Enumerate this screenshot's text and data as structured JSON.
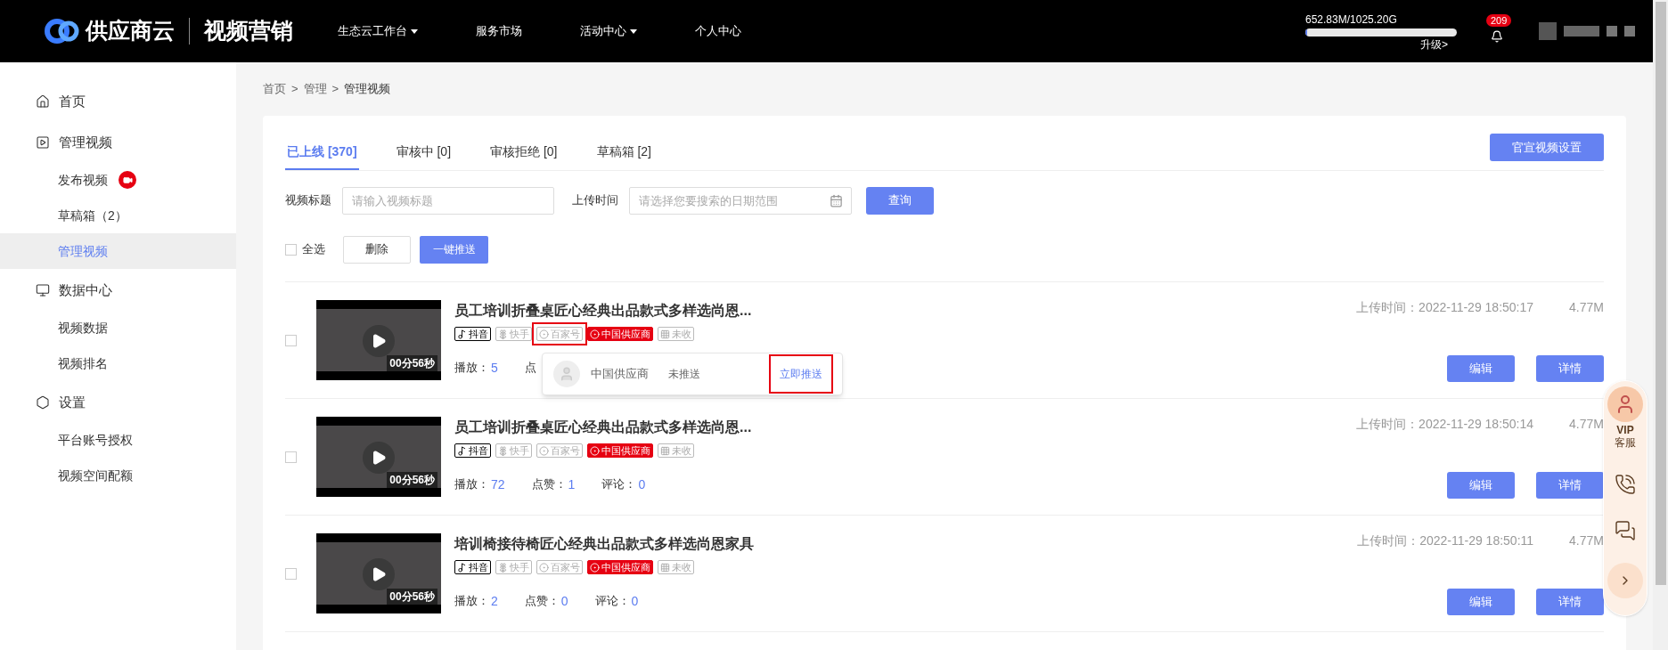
{
  "header": {
    "brand": "供应商云",
    "product": "视频营销",
    "nav": [
      {
        "label": "生态云工作台",
        "has_menu": true
      },
      {
        "label": "服务市场",
        "has_menu": false
      },
      {
        "label": "活动中心",
        "has_menu": true
      },
      {
        "label": "个人中心",
        "has_menu": false
      }
    ],
    "storage": {
      "reading": "652.83M/1025.20G",
      "level": 0.01,
      "upgrade": "升级>"
    },
    "notifications": "209"
  },
  "sidebar": {
    "items": [
      {
        "kind": "home",
        "label": "首页",
        "selected": false
      },
      {
        "kind": "videos",
        "label": "管理视频",
        "selected": false
      },
      {
        "kind": "sub",
        "label": "发布视频",
        "badge": true,
        "selected": false
      },
      {
        "kind": "sub",
        "label": "草稿箱（2）",
        "badge": false,
        "selected": false
      },
      {
        "kind": "sub",
        "label": "管理视频",
        "badge": false,
        "selected": true
      },
      {
        "kind": "data",
        "label": "数据中心",
        "selected": false
      },
      {
        "kind": "sub",
        "label": "视频数据",
        "badge": false,
        "selected": false
      },
      {
        "kind": "sub",
        "label": "视频排名",
        "badge": false,
        "selected": false
      },
      {
        "kind": "settings",
        "label": "设置",
        "selected": false
      },
      {
        "kind": "sub",
        "label": "平台账号授权",
        "badge": false,
        "selected": false
      },
      {
        "kind": "sub",
        "label": "视频空间配额",
        "badge": false,
        "selected": false
      }
    ]
  },
  "breadcrumb": {
    "items": [
      "首页",
      "管理",
      "管理视频"
    ],
    "separator": ">"
  },
  "tabs": [
    {
      "label": "已上线 [370]",
      "selected": true
    },
    {
      "label": "审核中 [0]",
      "selected": false
    },
    {
      "label": "审核拒绝 [0]",
      "selected": false
    },
    {
      "label": "草稿箱 [2]",
      "selected": false
    }
  ],
  "settings_button": "官宣视频设置",
  "filters": [
    {
      "kind": "text",
      "label": "视频标题",
      "placeholder": "请输入视频标题"
    },
    {
      "kind": "date",
      "label": "上传时间",
      "placeholder": "请选择您要搜索的日期范围"
    }
  ],
  "search_button": "查询",
  "bulk": {
    "select_all": "全选",
    "checked": false,
    "delete": "删除",
    "push": "一键推送"
  },
  "videos": [
    {
      "checked": false,
      "duration": "00分56秒",
      "title": "员工培训折叠桌匠心经典出品款式多样选尚恩...",
      "uploaded": "上传时间：2022-11-29 18:50:17",
      "size": "4.77M",
      "platforms": [
        {
          "kind": "douyin",
          "label": "抖音",
          "active": true,
          "highlighted": false
        },
        {
          "kind": "kuaishou",
          "label": "快手",
          "active": false,
          "highlighted": false
        },
        {
          "kind": "baijiahao",
          "label": "百家号",
          "active": false,
          "highlighted": true
        },
        {
          "kind": "supplier",
          "label": "中国供应商",
          "active": true,
          "highlighted": false
        },
        {
          "kind": "weishou",
          "label": "未收",
          "active": false,
          "highlighted": false
        }
      ],
      "stats": [
        {
          "label": "播放：",
          "value": "5"
        },
        {
          "label": "点"
        }
      ],
      "popup": {
        "account": "中国供应商",
        "status": "未推送",
        "action": "立即推送",
        "highlighted": true
      },
      "edit": "编辑",
      "details": "详情"
    },
    {
      "checked": false,
      "duration": "00分56秒",
      "title": "员工培训折叠桌匠心经典出品款式多样选尚恩...",
      "uploaded": "上传时间：2022-11-29 18:50:14",
      "size": "4.77M",
      "platforms": [
        {
          "kind": "douyin",
          "label": "抖音",
          "active": true,
          "highlighted": false
        },
        {
          "kind": "kuaishou",
          "label": "快手",
          "active": false,
          "highlighted": false
        },
        {
          "kind": "baijiahao",
          "label": "百家号",
          "active": false,
          "highlighted": false
        },
        {
          "kind": "supplier",
          "label": "中国供应商",
          "active": true,
          "highlighted": false
        },
        {
          "kind": "weishou",
          "label": "未收",
          "active": false,
          "highlighted": false
        }
      ],
      "stats": [
        {
          "label": "播放：",
          "value": "72"
        },
        {
          "label": "点赞：",
          "value": "1"
        },
        {
          "label": "评论：",
          "value": "0"
        }
      ],
      "edit": "编辑",
      "details": "详情"
    },
    {
      "checked": false,
      "duration": "00分56秒",
      "title": "培训椅接待椅匠心经典出品款式多样选尚恩家具",
      "uploaded": "上传时间：2022-11-29 18:50:11",
      "size": "4.77M",
      "platforms": [
        {
          "kind": "douyin",
          "label": "抖音",
          "active": true,
          "highlighted": false
        },
        {
          "kind": "kuaishou",
          "label": "快手",
          "active": false,
          "highlighted": false
        },
        {
          "kind": "baijiahao",
          "label": "百家号",
          "active": false,
          "highlighted": false
        },
        {
          "kind": "supplier",
          "label": "中国供应商",
          "active": true,
          "highlighted": false
        },
        {
          "kind": "weishou",
          "label": "未收",
          "active": false,
          "highlighted": false
        }
      ],
      "stats": [
        {
          "label": "播放：",
          "value": "2"
        },
        {
          "label": "点赞：",
          "value": "0"
        },
        {
          "label": "评论：",
          "value": "0"
        }
      ],
      "edit": "编辑",
      "details": "详情"
    }
  ],
  "service_widget": {
    "title": "VIP",
    "subtitle": "客服"
  }
}
